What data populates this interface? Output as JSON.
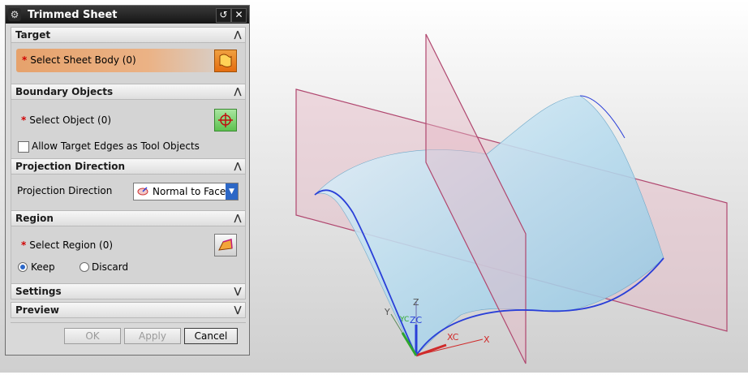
{
  "dialog": {
    "title": "Trimmed Sheet",
    "icons": {
      "settings": "gear-icon",
      "reset": "reset-arrow-icon",
      "close": "close-icon"
    }
  },
  "sections": {
    "target": {
      "title": "Target",
      "select_label": "Select Sheet Body (0)",
      "required_marker": "*"
    },
    "boundary": {
      "title": "Boundary Objects",
      "select_label": "Select Object (0)",
      "required_marker": "*",
      "checkbox_label": "Allow Target Edges as Tool Objects",
      "checkbox_checked": false
    },
    "projection": {
      "title": "Projection Direction",
      "field_label": "Projection Direction",
      "selected_value": "Normal to Face"
    },
    "region": {
      "title": "Region",
      "select_label": "Select Region (0)",
      "required_marker": "*",
      "options": [
        "Keep",
        "Discard"
      ],
      "selected": "Keep"
    },
    "settings": {
      "title": "Settings"
    },
    "preview": {
      "title": "Preview"
    }
  },
  "buttons": {
    "ok": "OK",
    "apply": "Apply",
    "cancel": "Cancel"
  },
  "viewport": {
    "axes": {
      "x": "X",
      "y": "Y",
      "z": "Z",
      "xc": "XC",
      "yc": "YC",
      "zc": "ZC"
    }
  },
  "colors": {
    "selection_highlight": "#e8a06a",
    "surface_fill": "#b9dcee",
    "plane_edge": "#b0476f",
    "curve_blue": "#2a3fd8"
  }
}
